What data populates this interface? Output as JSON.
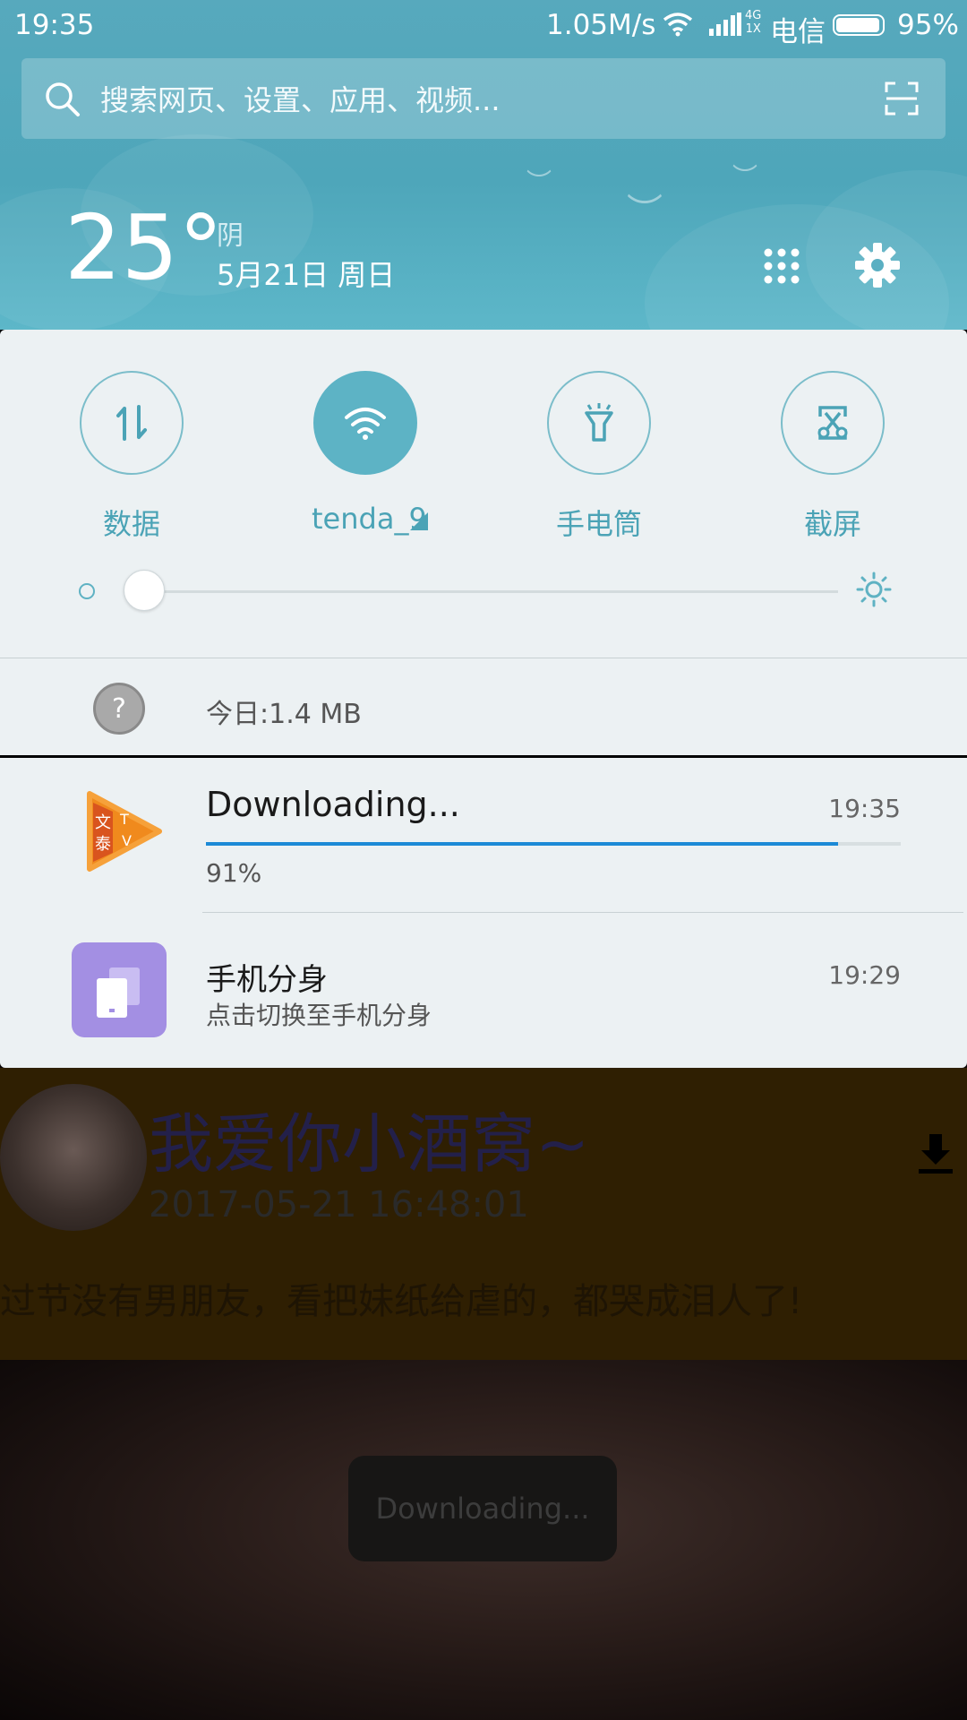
{
  "status_bar": {
    "time": "19:35",
    "net_speed": "1.05M/s",
    "network_type_top": "4G",
    "network_type_bottom": "1X",
    "carrier": "电信",
    "battery_percent": "95%",
    "battery_level": 0.95
  },
  "search": {
    "placeholder": "搜索网页、设置、应用、视频..."
  },
  "weather": {
    "temperature": "25°",
    "condition": "阴",
    "date": "5月21日 周日"
  },
  "quick_settings": {
    "tiles": [
      {
        "label": "数据",
        "icon": "data-arrows-icon",
        "active": false
      },
      {
        "label": "tenda_9",
        "icon": "wifi-icon",
        "active": true
      },
      {
        "label": "手电筒",
        "icon": "flashlight-icon",
        "active": false
      },
      {
        "label": "截屏",
        "icon": "screenshot-scissors-icon",
        "active": false
      }
    ],
    "brightness_level": 0.02,
    "data_usage": "今日:1.4 MB"
  },
  "notifications": [
    {
      "title": "Downloading...",
      "time": "19:35",
      "progress_text": "91%",
      "progress": 0.91,
      "icon": "app-play-logo-icon",
      "icon_text": [
        "文",
        "泰",
        "T",
        "V"
      ]
    },
    {
      "title": "手机分身",
      "subtitle": "点击切换至手机分身",
      "time": "19:29",
      "icon": "second-space-icon"
    }
  ],
  "background_app": {
    "post_title": "我爱你小酒窝~",
    "post_date": "2017-05-21 16:48:01",
    "post_text": "过节没有男朋友，看把妹纸给虐的，都哭成泪人了!",
    "toast": "Downloading..."
  },
  "colors": {
    "header": "#55a9bc",
    "accent": "#4ba3b6",
    "progress": "#1c8ad6",
    "panel": "#ecf1f3"
  }
}
